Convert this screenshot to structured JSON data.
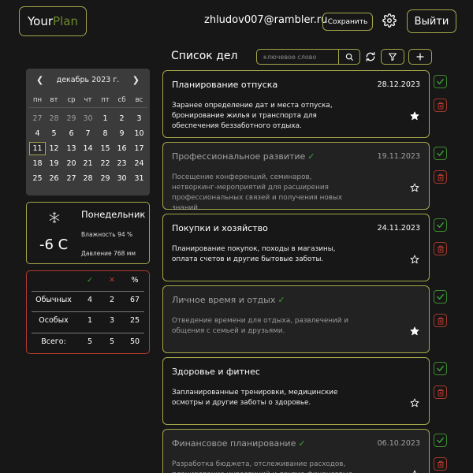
{
  "header": {
    "logo_a": "Your",
    "logo_b": "Plan",
    "email": "zhludov007@rambler.ru",
    "save_label": "Сохранить",
    "logout_label": "Выйти"
  },
  "calendar": {
    "month": "декабрь 2023 г.",
    "prev": "❮",
    "next": "❯",
    "weekdays": [
      "пн",
      "вт",
      "ср",
      "чт",
      "пт",
      "сб",
      "вс"
    ],
    "weeks": [
      [
        "27",
        "28",
        "29",
        "30",
        "1",
        "2",
        "3"
      ],
      [
        "4",
        "5",
        "6",
        "7",
        "8",
        "9",
        "10"
      ],
      [
        "11",
        "12",
        "13",
        "14",
        "15",
        "16",
        "17"
      ],
      [
        "18",
        "19",
        "20",
        "21",
        "22",
        "23",
        "24"
      ],
      [
        "25",
        "26",
        "27",
        "28",
        "29",
        "30",
        "31"
      ]
    ],
    "muted": [
      [
        0,
        0
      ],
      [
        0,
        1
      ],
      [
        0,
        2
      ],
      [
        0,
        3
      ]
    ],
    "today": [
      2,
      0
    ]
  },
  "weather": {
    "icon": "snowflake-icon",
    "temp": "-6 C",
    "day": "Понедельник",
    "humidity": "Влажность 94 %",
    "pressure": "Давление 768 мм"
  },
  "stats": {
    "check": "✓",
    "cross": "✕",
    "percent": "%",
    "rows": [
      {
        "label": "Обычных",
        "done": "4",
        "fail": "2",
        "pct": "67"
      },
      {
        "label": "Особых",
        "done": "1",
        "fail": "3",
        "pct": "25"
      },
      {
        "label": "Всего:",
        "done": "5",
        "fail": "5",
        "pct": "50"
      }
    ]
  },
  "list": {
    "title": "Список дел",
    "search_placeholder": "ключевое слово"
  },
  "tasks": [
    {
      "title": "Планирование отпуска",
      "date": "28.12.2023",
      "done": false,
      "starred": true,
      "desc": "Заранее определение дат и места отпуска, бронирование жилья и транспорта для обеспечения беззаботного отдыха."
    },
    {
      "title": "Профессиональное развитие",
      "date": "19.11.2023",
      "done": true,
      "starred": false,
      "desc": "Посещение конференций, семинаров, нетворкинг-мероприятий для расширения профессиональных связей и получения новых знаний."
    },
    {
      "title": "Покупки и хозяйство",
      "date": "24.11.2023",
      "done": false,
      "starred": false,
      "desc": "Планирование покупок, походы в магазины, оплата счетов и другие бытовые заботы."
    },
    {
      "title": "Личное время и отдых",
      "date": "",
      "done": true,
      "starred": true,
      "desc": "Отведение времени для отдыха, развлечений и общения с семьей и друзьями."
    },
    {
      "title": "Здоровье и фитнес",
      "date": "",
      "done": false,
      "starred": false,
      "desc": "Запланированные тренировки, медицинские осмотры и другие заботы о здоровье."
    },
    {
      "title": "Финансовое планирование",
      "date": "06.10.2023",
      "done": true,
      "starred": false,
      "desc": "Разработка бюджета, отслеживание расходов, планирование инвестиций и другие финансовые"
    }
  ],
  "colors": {
    "accent": "#a4a64a",
    "ok": "#3aa53a",
    "danger": "#b33a2c",
    "logo_b": "#6d8a2a"
  }
}
